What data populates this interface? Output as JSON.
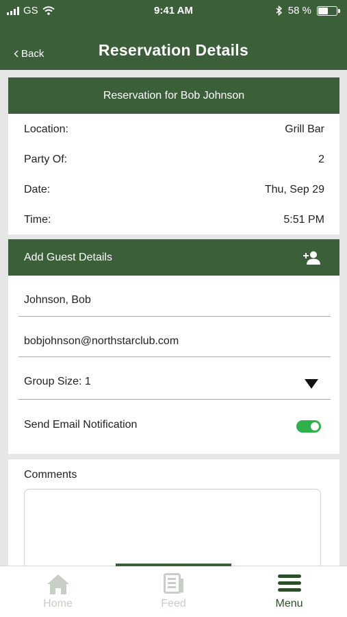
{
  "status_bar": {
    "carrier": "GS",
    "time": "9:41 AM",
    "battery": "58 %",
    "battery_level": 0.58
  },
  "nav": {
    "back_label": "Back",
    "title": "Reservation Details"
  },
  "reservation": {
    "header": "Reservation for Bob Johnson",
    "rows": [
      {
        "label": "Location:",
        "value": "Grill Bar"
      },
      {
        "label": "Party Of:",
        "value": "2"
      },
      {
        "label": "Date:",
        "value": "Thu, Sep 29"
      },
      {
        "label": "Time:",
        "value": "5:51 PM"
      }
    ]
  },
  "guest": {
    "header": "Add Guest Details",
    "name": "Johnson, Bob",
    "email": "bobjohnson@northstarclub.com",
    "group_size": "Group Size: 1",
    "notification_label": "Send Email Notification",
    "notification_on": true,
    "add_icon": "add-person-icon"
  },
  "comments": {
    "label": "Comments",
    "value": ""
  },
  "tabs": [
    {
      "label": "Home",
      "icon": "home-icon",
      "active": false
    },
    {
      "label": "Feed",
      "icon": "feed-icon",
      "active": false
    },
    {
      "label": "Menu",
      "icon": "menu-icon",
      "active": true
    }
  ],
  "colors": {
    "brand_green": "#3b5f38",
    "toggle_green": "#2fb24c",
    "inactive_tab": "#c7cec6"
  }
}
